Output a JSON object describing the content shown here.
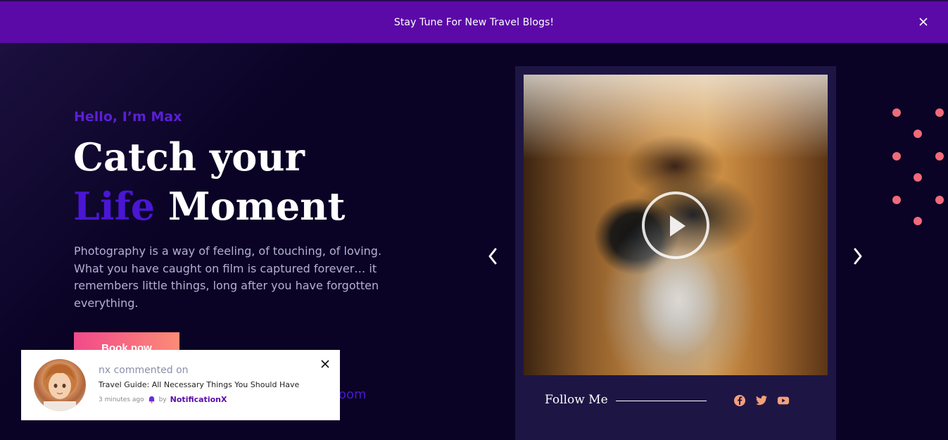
{
  "topbar": {
    "announcement": "Stay Tune For New Travel Blogs!",
    "close_icon": "close-icon",
    "background": "#5b0aa8"
  },
  "hero": {
    "greeting": "Hello, I’m Max",
    "headline_line1": "Catch your",
    "headline_accent": "Life",
    "headline_rest": "Moment",
    "description": "Photography is a way of feeling, of touching, of loving. What you have caught on film is captured forever… it remembers little things, long after you have forgotten everything.",
    "cta_label": "Book now",
    "secondary_link_partial": "oom",
    "accent_color": "#4a16d4"
  },
  "notification": {
    "title": "nx commented on",
    "body": "Travel Guide: All Necessary Things You Should Have",
    "time": "3 minutes ago",
    "by": "by",
    "brand": "NotificationX"
  },
  "media_card": {
    "play_icon": "play-icon",
    "follow_label": "Follow Me",
    "socials": [
      "facebook-icon",
      "twitter-icon",
      "youtube-icon"
    ],
    "social_color": "#f3a07a"
  },
  "carousel": {
    "prev_icon": "chevron-left-icon",
    "next_icon": "chevron-right-icon"
  }
}
